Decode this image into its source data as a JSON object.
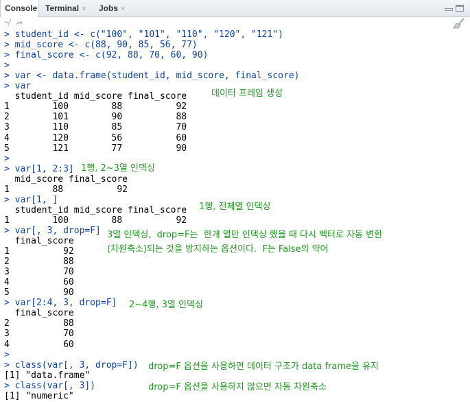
{
  "tabs": [
    {
      "label": "Console",
      "active": true
    },
    {
      "label": "Terminal",
      "close": "×"
    },
    {
      "label": "Jobs",
      "close": "×"
    }
  ],
  "path": "~/",
  "console_lines": [
    {
      "text": "> student_id <- c(\"100\", \"101\", \"110\", \"120\", \"121\")",
      "kind": "cmd"
    },
    {
      "text": "> mid_score <- c(88, 90, 85, 56, 77)",
      "kind": "cmd"
    },
    {
      "text": "> final_score <- c(92, 88, 70, 60, 90)",
      "kind": "cmd"
    },
    {
      "text": ">",
      "kind": "cmd"
    },
    {
      "text": "> var <- data.frame(student_id, mid_score, final_score)",
      "kind": "cmd"
    },
    {
      "text": "> var",
      "kind": "cmd"
    },
    {
      "text": "  student_id mid_score final_score",
      "kind": "out"
    },
    {
      "text": "1        100        88          92",
      "kind": "out"
    },
    {
      "text": "2        101        90          88",
      "kind": "out"
    },
    {
      "text": "3        110        85          70",
      "kind": "out"
    },
    {
      "text": "4        120        56          60",
      "kind": "out"
    },
    {
      "text": "5        121        77          90",
      "kind": "out"
    },
    {
      "text": ">",
      "kind": "cmd"
    },
    {
      "text": "> var[1, 2:3]",
      "kind": "cmd"
    },
    {
      "text": "  mid_score final_score",
      "kind": "out"
    },
    {
      "text": "1        88          92",
      "kind": "out"
    },
    {
      "text": "> var[1, ]",
      "kind": "cmd"
    },
    {
      "text": "  student_id mid_score final_score",
      "kind": "out"
    },
    {
      "text": "1        100        88          92",
      "kind": "out"
    },
    {
      "text": "> var[, 3, drop=F]",
      "kind": "cmd"
    },
    {
      "text": "  final_score",
      "kind": "out"
    },
    {
      "text": "1          92",
      "kind": "out"
    },
    {
      "text": "2          88",
      "kind": "out"
    },
    {
      "text": "3          70",
      "kind": "out"
    },
    {
      "text": "4          60",
      "kind": "out"
    },
    {
      "text": "5          90",
      "kind": "out"
    },
    {
      "text": "> var[2:4, 3, drop=F]",
      "kind": "cmd"
    },
    {
      "text": "  final_score",
      "kind": "out"
    },
    {
      "text": "2          88",
      "kind": "out"
    },
    {
      "text": "3          70",
      "kind": "out"
    },
    {
      "text": "4          60",
      "kind": "out"
    },
    {
      "text": ">",
      "kind": "cmd"
    },
    {
      "text": "> class(var[, 3, drop=F])",
      "kind": "cmd"
    },
    {
      "text": "[1] \"data.frame\"",
      "kind": "out"
    },
    {
      "text": "> class(var[, 3])",
      "kind": "cmd"
    },
    {
      "text": "[1] \"numeric\"",
      "kind": "out"
    }
  ],
  "annotations": [
    "데이터 프레임 생성",
    "1행, 2~3열 인덱싱",
    "1행, 전체열 인덱싱",
    "3열 인덱싱,  drop=F는  한개 열만 인덱싱 했을 때 다시 벡터로 자동 변환",
    "(차원축소)되는 것을 방지하는 옵션이다.  F는 False의 약어",
    "2~4행, 3열 인덱싱",
    "drop=F 옵션을 사용하면 데이터 구조가 data frame을 유지",
    "drop=F 옵션을 사용하지 않으면 자동 차원축소"
  ],
  "colors": {
    "command": "#0b3fa8",
    "output": "#000000",
    "annotation": "#1e9b1e"
  }
}
